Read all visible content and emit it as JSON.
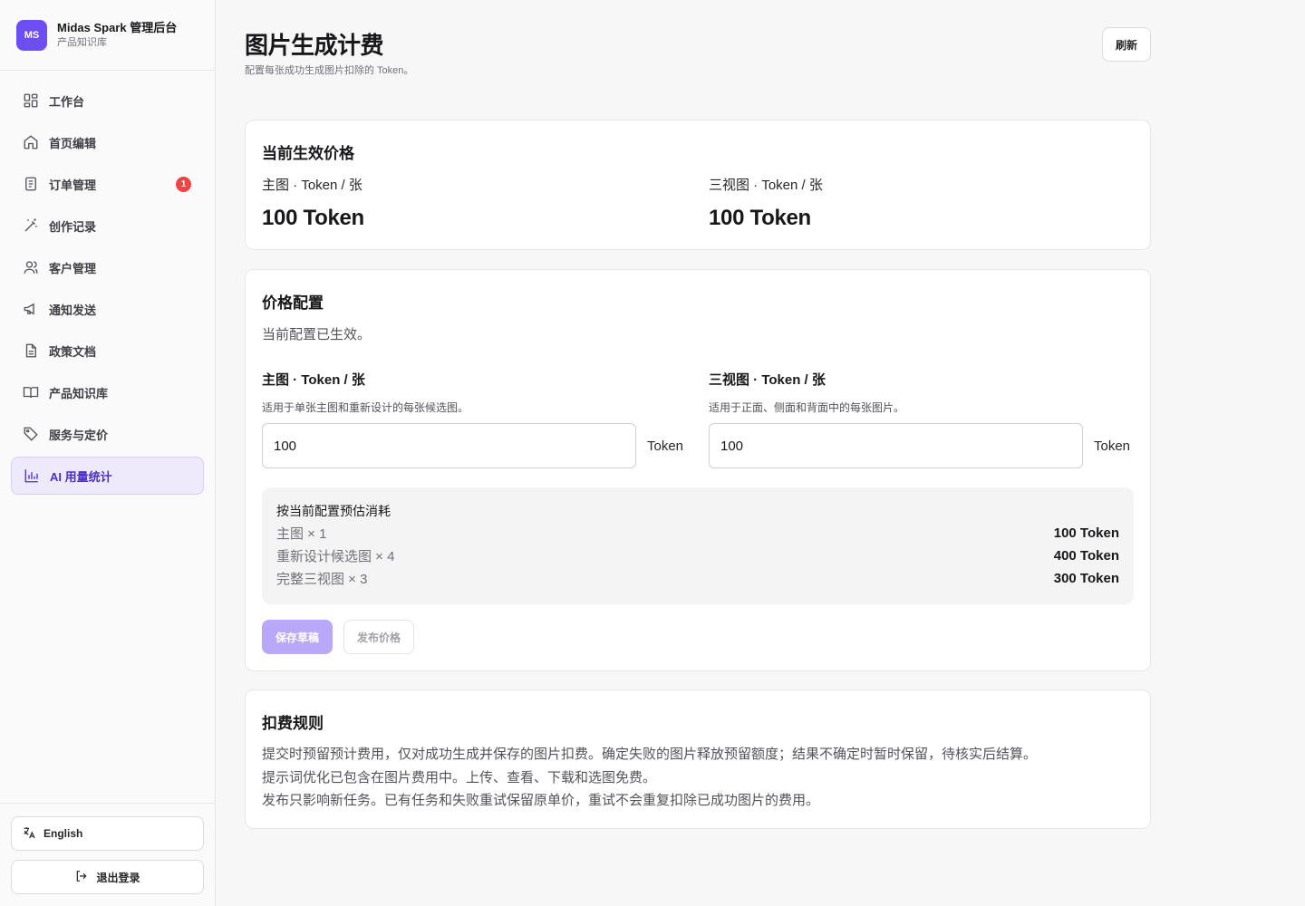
{
  "brand": {
    "logo": "MS",
    "name": "Midas Spark 管理后台",
    "sub": "产品知识库"
  },
  "sidebar": {
    "items": [
      {
        "label": "工作台",
        "icon": "dashboard-icon"
      },
      {
        "label": "首页编辑",
        "icon": "home-icon"
      },
      {
        "label": "订单管理",
        "icon": "order-icon",
        "badge": "1"
      },
      {
        "label": "创作记录",
        "icon": "magic-wand-icon"
      },
      {
        "label": "客户管理",
        "icon": "user-icon"
      },
      {
        "label": "通知发送",
        "icon": "megaphone-icon"
      },
      {
        "label": "政策文档",
        "icon": "document-icon"
      },
      {
        "label": "产品知识库",
        "icon": "book-icon"
      },
      {
        "label": "服务与定价",
        "icon": "tag-icon"
      },
      {
        "label": "AI 用量统计",
        "icon": "bar-chart-icon",
        "active": true
      }
    ],
    "language_label": "English",
    "logout_label": "退出登录"
  },
  "header": {
    "title": "图片生成计费",
    "subtitle": "配置每张成功生成图片扣除的 Token。",
    "refresh_label": "刷新"
  },
  "current_price": {
    "title": "当前生效价格",
    "main_label": "主图 · Token / 张",
    "main_value": "100 Token",
    "three_label": "三视图 · Token / 张",
    "three_value": "100 Token"
  },
  "config": {
    "title": "价格配置",
    "status": "当前配置已生效。",
    "main": {
      "label": "主图 · Token / 张",
      "help": "适用于单张主图和重新设计的每张候选图。",
      "value": "100",
      "unit": "Token"
    },
    "three": {
      "label": "三视图 · Token / 张",
      "help": "适用于正面、侧面和背面中的每张图片。",
      "value": "100",
      "unit": "Token"
    },
    "estimate": {
      "title": "按当前配置预估消耗",
      "rows": [
        {
          "label": "主图 × 1",
          "value": "100 Token"
        },
        {
          "label": "重新设计候选图 × 4",
          "value": "400 Token"
        },
        {
          "label": "完整三视图 × 3",
          "value": "300 Token"
        }
      ]
    },
    "save_label": "保存草稿",
    "publish_label": "发布价格"
  },
  "rules": {
    "title": "扣费规则",
    "lines": [
      "提交时预留预计费用，仅对成功生成并保存的图片扣费。确定失败的图片释放预留额度；结果不确定时暂时保留，待核实后结算。",
      "提示词优化已包含在图片费用中。上传、查看、下载和选图免费。",
      "发布只影响新任务。已有任务和失败重试保留原单价，重试不会重复扣除已成功图片的费用。"
    ]
  },
  "colors": {
    "accent": "#6d4ef2",
    "badge": "#ef4444",
    "active_bg": "#eeeafc"
  }
}
